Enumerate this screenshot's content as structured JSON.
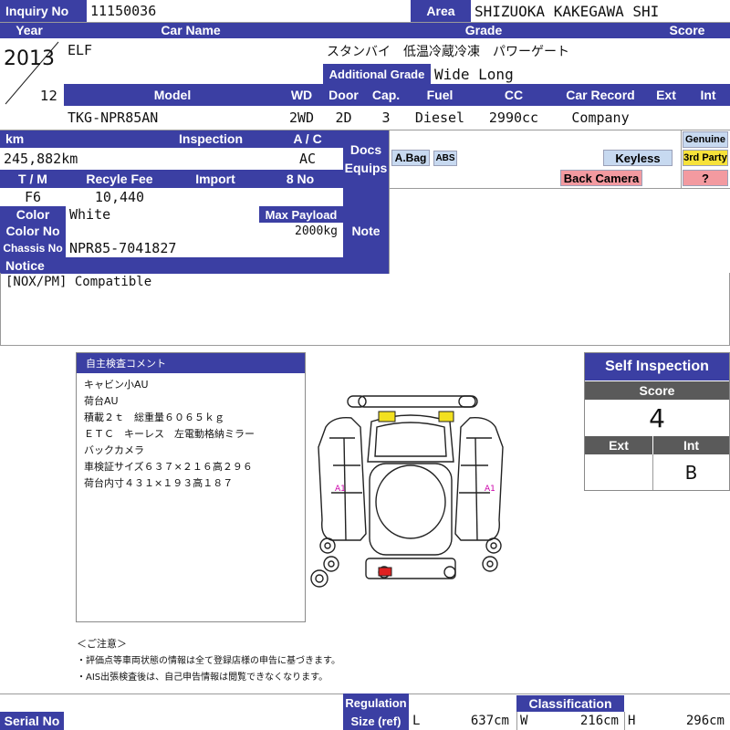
{
  "header": {
    "inquiry_label": "Inquiry No",
    "inquiry_no": "11150036",
    "area_label": "Area",
    "area": "SHIZUOKA KAKEGAWA SHI"
  },
  "vehicle": {
    "year_label": "Year",
    "year": "2013",
    "month": "12",
    "car_name_label": "Car Name",
    "car_name": "ELF",
    "grade_label": "Grade",
    "grade": "スタンバイ　低温冷蔵冷凍　パワーゲート",
    "additional_grade_label": "Additional Grade",
    "additional_grade": "Wide Long",
    "score_label": "Score",
    "score": "",
    "model_label": "Model",
    "model": "TKG-NPR85AN",
    "wd_label": "WD",
    "wd": "2WD",
    "door_label": "Door",
    "door": "2D",
    "cap_label": "Cap.",
    "cap": "3",
    "fuel_label": "Fuel",
    "fuel": "Diesel",
    "cc_label": "CC",
    "cc": "2990cc",
    "car_record_label": "Car Record",
    "car_record": "Company",
    "ext_label": "Ext",
    "ext": "",
    "int_label": "Int",
    "int": ""
  },
  "details": {
    "km_label": "km",
    "km": "245,882km",
    "inspection_label": "Inspection",
    "inspection": "",
    "ac_label": "A / C",
    "ac": "AC",
    "docs_label": "Docs",
    "equips_label": "Equips",
    "tm_label": "T / M",
    "tm": "F6",
    "recycle_label": "Recyle Fee",
    "recycle": "10,440",
    "import_label": "Import",
    "import": "",
    "eightno_label": "8 No",
    "eightno": "",
    "color_label": "Color",
    "color": "White",
    "max_payload_label": "Max Payload",
    "max_payload": "2000kg",
    "color_no_label": "Color No",
    "color_no": "",
    "chassis_label": "Chassis No",
    "chassis": "NPR85-7041827",
    "note_label": "Note",
    "notice_label": "Notice",
    "notice": "[NOX/PM] Compatible"
  },
  "equips": {
    "airbag": "A.Bag",
    "abs": "ABS",
    "keyless": "Keyless",
    "back_camera": "Back Camera",
    "genuine": "Genuine",
    "third_party": "3rd Party",
    "unknown": "?"
  },
  "comment": {
    "title": "自主検査コメント",
    "lines": [
      "キャビン小AU",
      "荷台AU",
      "積載２ｔ　総重量６０６５ｋｇ",
      "ＥＴＣ　キーレス　左電動格納ミラー",
      "バックカメラ",
      "車検証サイズ６３７×２１６高２９６",
      "荷台内寸４３１×１９３高１８７"
    ]
  },
  "diagram": {
    "left_mark": "A1",
    "right_mark": "A1"
  },
  "self_inspection": {
    "title": "Self Inspection",
    "score_label": "Score",
    "score": "4",
    "ext_label": "Ext",
    "ext": "",
    "int_label": "Int",
    "int": "B"
  },
  "notes": {
    "heading": "＜ご注意＞",
    "line1": "・評価点等車両状態の情報は全て登録店様の申告に基づきます。",
    "line2": "・AIS出張検査後は、自己申告情報は閲覧できなくなります。"
  },
  "footer": {
    "serial_label": "Serial No",
    "serial": "",
    "regulation_label": "Regulation",
    "size_label": "Size (ref)",
    "classification_label": "Classification",
    "l_label": "L",
    "l": "637cm",
    "w_label": "W",
    "w": "216cm",
    "h_label": "H",
    "h": "296cm"
  },
  "colors": {
    "header_bg": "#3b3fa3",
    "badge_blue": "#c7d9f0",
    "badge_pink": "#f39aa0",
    "badge_yellow": "#f7e23a",
    "damage_yellow": "#f2e020",
    "damage_red": "#e02020"
  }
}
